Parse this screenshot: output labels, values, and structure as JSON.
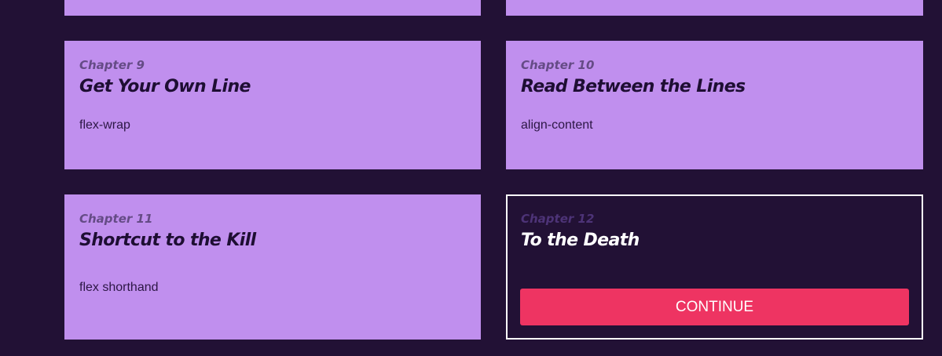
{
  "chapters": [
    {
      "chapter": "",
      "title": "",
      "topic": ""
    },
    {
      "chapter": "",
      "title": "",
      "topic": ""
    },
    {
      "chapter": "Chapter 9",
      "title": "Get Your Own Line",
      "topic": "flex-wrap"
    },
    {
      "chapter": "Chapter 10",
      "title": "Read Between the Lines",
      "topic": "align-content"
    },
    {
      "chapter": "Chapter 11",
      "title": "Shortcut to the Kill",
      "topic": "flex shorthand"
    },
    {
      "chapter": "Chapter 12",
      "title": "To the Death",
      "topic": ""
    }
  ],
  "current": {
    "continue_label": "CONTINUE"
  },
  "colors": {
    "background": "#221135",
    "card": "#c08fee",
    "accent": "#ee3462",
    "active_border": "#ffffff"
  }
}
